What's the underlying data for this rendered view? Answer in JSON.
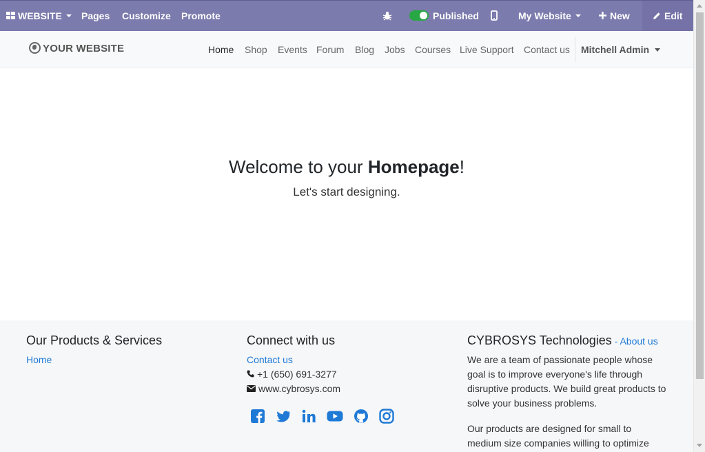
{
  "admin_bar": {
    "app_label": "WEBSITE",
    "menu": [
      "Pages",
      "Customize",
      "Promote"
    ],
    "published_label": "Published",
    "website_selector": "My Website",
    "new_label": "New",
    "edit_label": "Edit",
    "bar_color": "#7c7bad"
  },
  "header": {
    "logo_text": "YOUR WEBSITE",
    "nav": [
      "Home",
      "Shop",
      "Events",
      "Forum",
      "Blog",
      "Jobs",
      "Courses",
      "Live Support",
      "Contact us"
    ],
    "active_nav": "Home",
    "user_name": "Mitchell Admin"
  },
  "hero": {
    "title_prefix": "Welcome to your ",
    "title_bold": "Homepage",
    "title_suffix": "!",
    "subtitle": "Let's start designing."
  },
  "footer": {
    "col1": {
      "title": "Our Products & Services",
      "links": [
        "Home"
      ]
    },
    "col2": {
      "title": "Connect with us",
      "contact_link": "Contact us",
      "phone": "+1 (650) 691-3277",
      "website": "www.cybrosys.com",
      "social_icons": [
        "facebook-icon",
        "twitter-icon",
        "linkedin-icon",
        "youtube-icon",
        "github-icon",
        "instagram-icon"
      ]
    },
    "col3": {
      "title": "CYBROSYS Technologies",
      "title_sep": " - ",
      "about_link": "About us",
      "para1": "We are a team of passionate people whose goal is to improve everyone's life through disruptive products. We build great products to solve your business problems.",
      "para2": "Our products are designed for small to medium size companies willing to optimize"
    },
    "link_color": "#1f7ad6"
  }
}
